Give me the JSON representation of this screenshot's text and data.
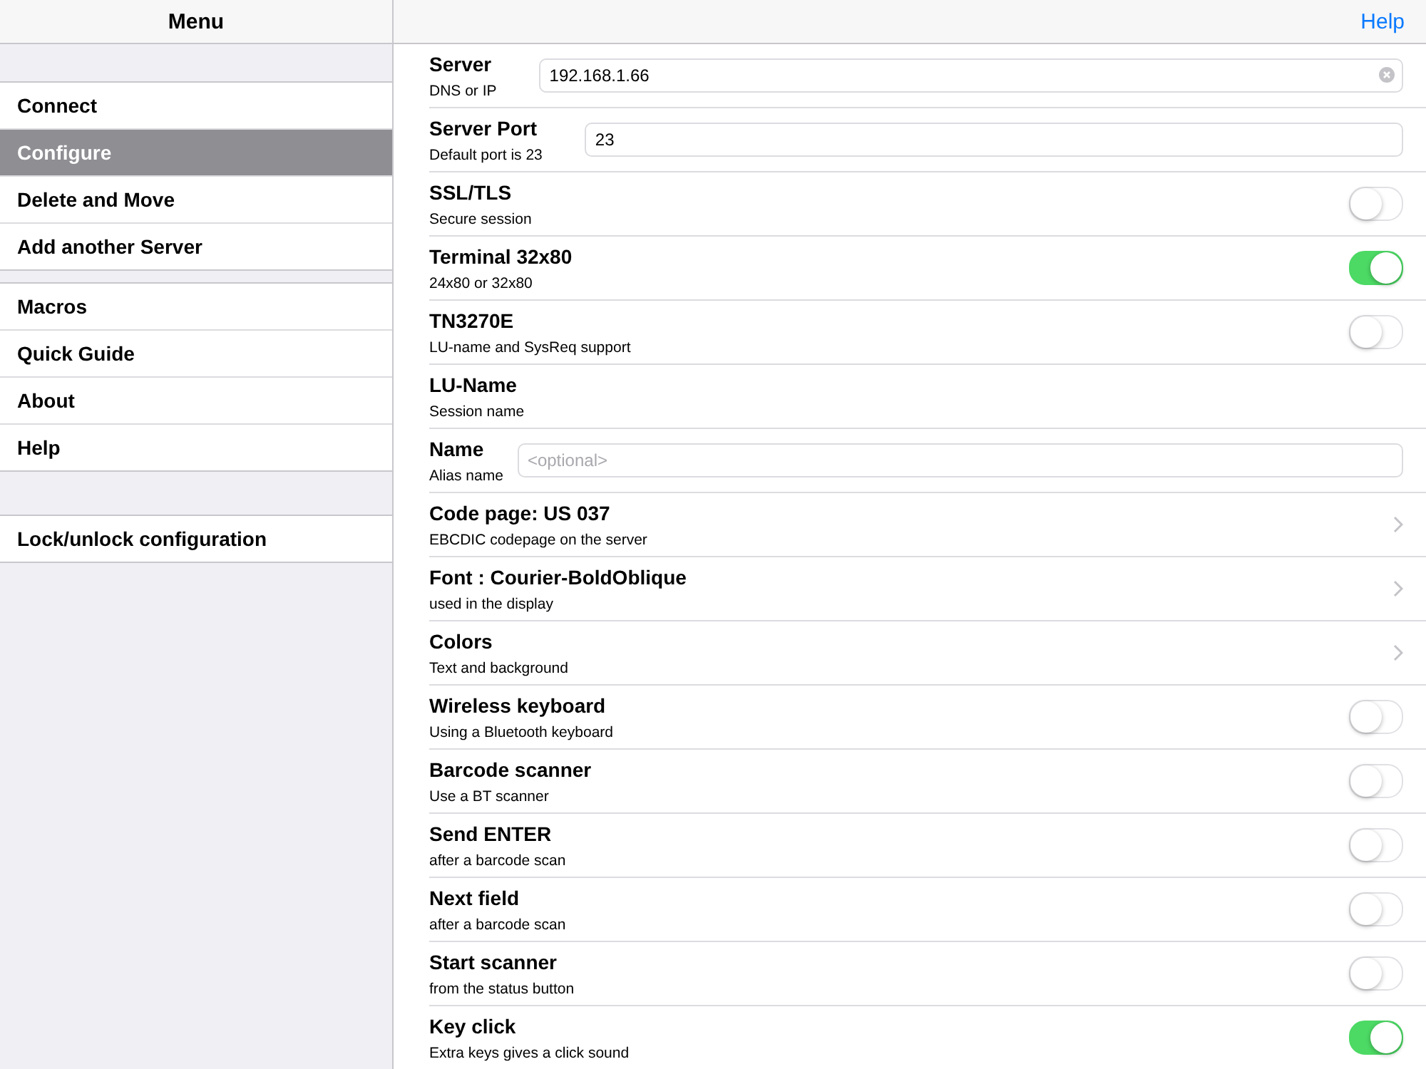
{
  "sidebar": {
    "title": "Menu",
    "groups": [
      {
        "items": [
          {
            "label": "Connect",
            "selected": false
          },
          {
            "label": "Configure",
            "selected": true
          },
          {
            "label": "Delete and Move",
            "selected": false
          },
          {
            "label": "Add another Server",
            "selected": false
          }
        ]
      },
      {
        "items": [
          {
            "label": "Macros",
            "selected": false
          },
          {
            "label": "Quick Guide",
            "selected": false
          },
          {
            "label": "About",
            "selected": false
          },
          {
            "label": "Help",
            "selected": false
          }
        ]
      },
      {
        "items": [
          {
            "label": "Lock/unlock configuration",
            "selected": false
          }
        ]
      }
    ]
  },
  "content": {
    "help_link": "Help",
    "rows": [
      {
        "kind": "field",
        "title": "Server",
        "subtitle": "DNS or IP",
        "value": "192.168.1.66",
        "clearable": true
      },
      {
        "kind": "field",
        "title": "Server Port",
        "subtitle": "Default port is 23",
        "value": "23",
        "clearable": false
      },
      {
        "kind": "toggle",
        "title": "SSL/TLS",
        "subtitle": "Secure session",
        "on": false
      },
      {
        "kind": "toggle",
        "title": "Terminal 32x80",
        "subtitle": "24x80 or 32x80",
        "on": true
      },
      {
        "kind": "toggle",
        "title": "TN3270E",
        "subtitle": "LU-name and SysReq support",
        "on": false
      },
      {
        "kind": "plain",
        "title": "LU-Name",
        "subtitle": "Session name"
      },
      {
        "kind": "field",
        "title": "Name",
        "subtitle": "Alias name",
        "placeholder": "<optional>",
        "clearable": false
      },
      {
        "kind": "disclosure",
        "title": "Code page: US  037",
        "subtitle": "EBCDIC codepage on the server"
      },
      {
        "kind": "disclosure",
        "title": "Font : Courier-BoldOblique",
        "subtitle": "used in the display"
      },
      {
        "kind": "disclosure",
        "title": "Colors",
        "subtitle": "Text and background"
      },
      {
        "kind": "toggle",
        "title": "Wireless keyboard",
        "subtitle": "Using a Bluetooth keyboard",
        "on": false
      },
      {
        "kind": "toggle",
        "title": "Barcode scanner",
        "subtitle": "Use a BT scanner",
        "on": false
      },
      {
        "kind": "toggle",
        "title": "Send ENTER",
        "subtitle": "after a barcode scan",
        "on": false
      },
      {
        "kind": "toggle",
        "title": "Next field",
        "subtitle": "after a barcode scan",
        "on": false
      },
      {
        "kind": "toggle",
        "title": "Start scanner",
        "subtitle": "from the status button",
        "on": false
      },
      {
        "kind": "toggle",
        "title": "Key click",
        "subtitle": "Extra keys gives a click sound",
        "on": true
      }
    ]
  }
}
